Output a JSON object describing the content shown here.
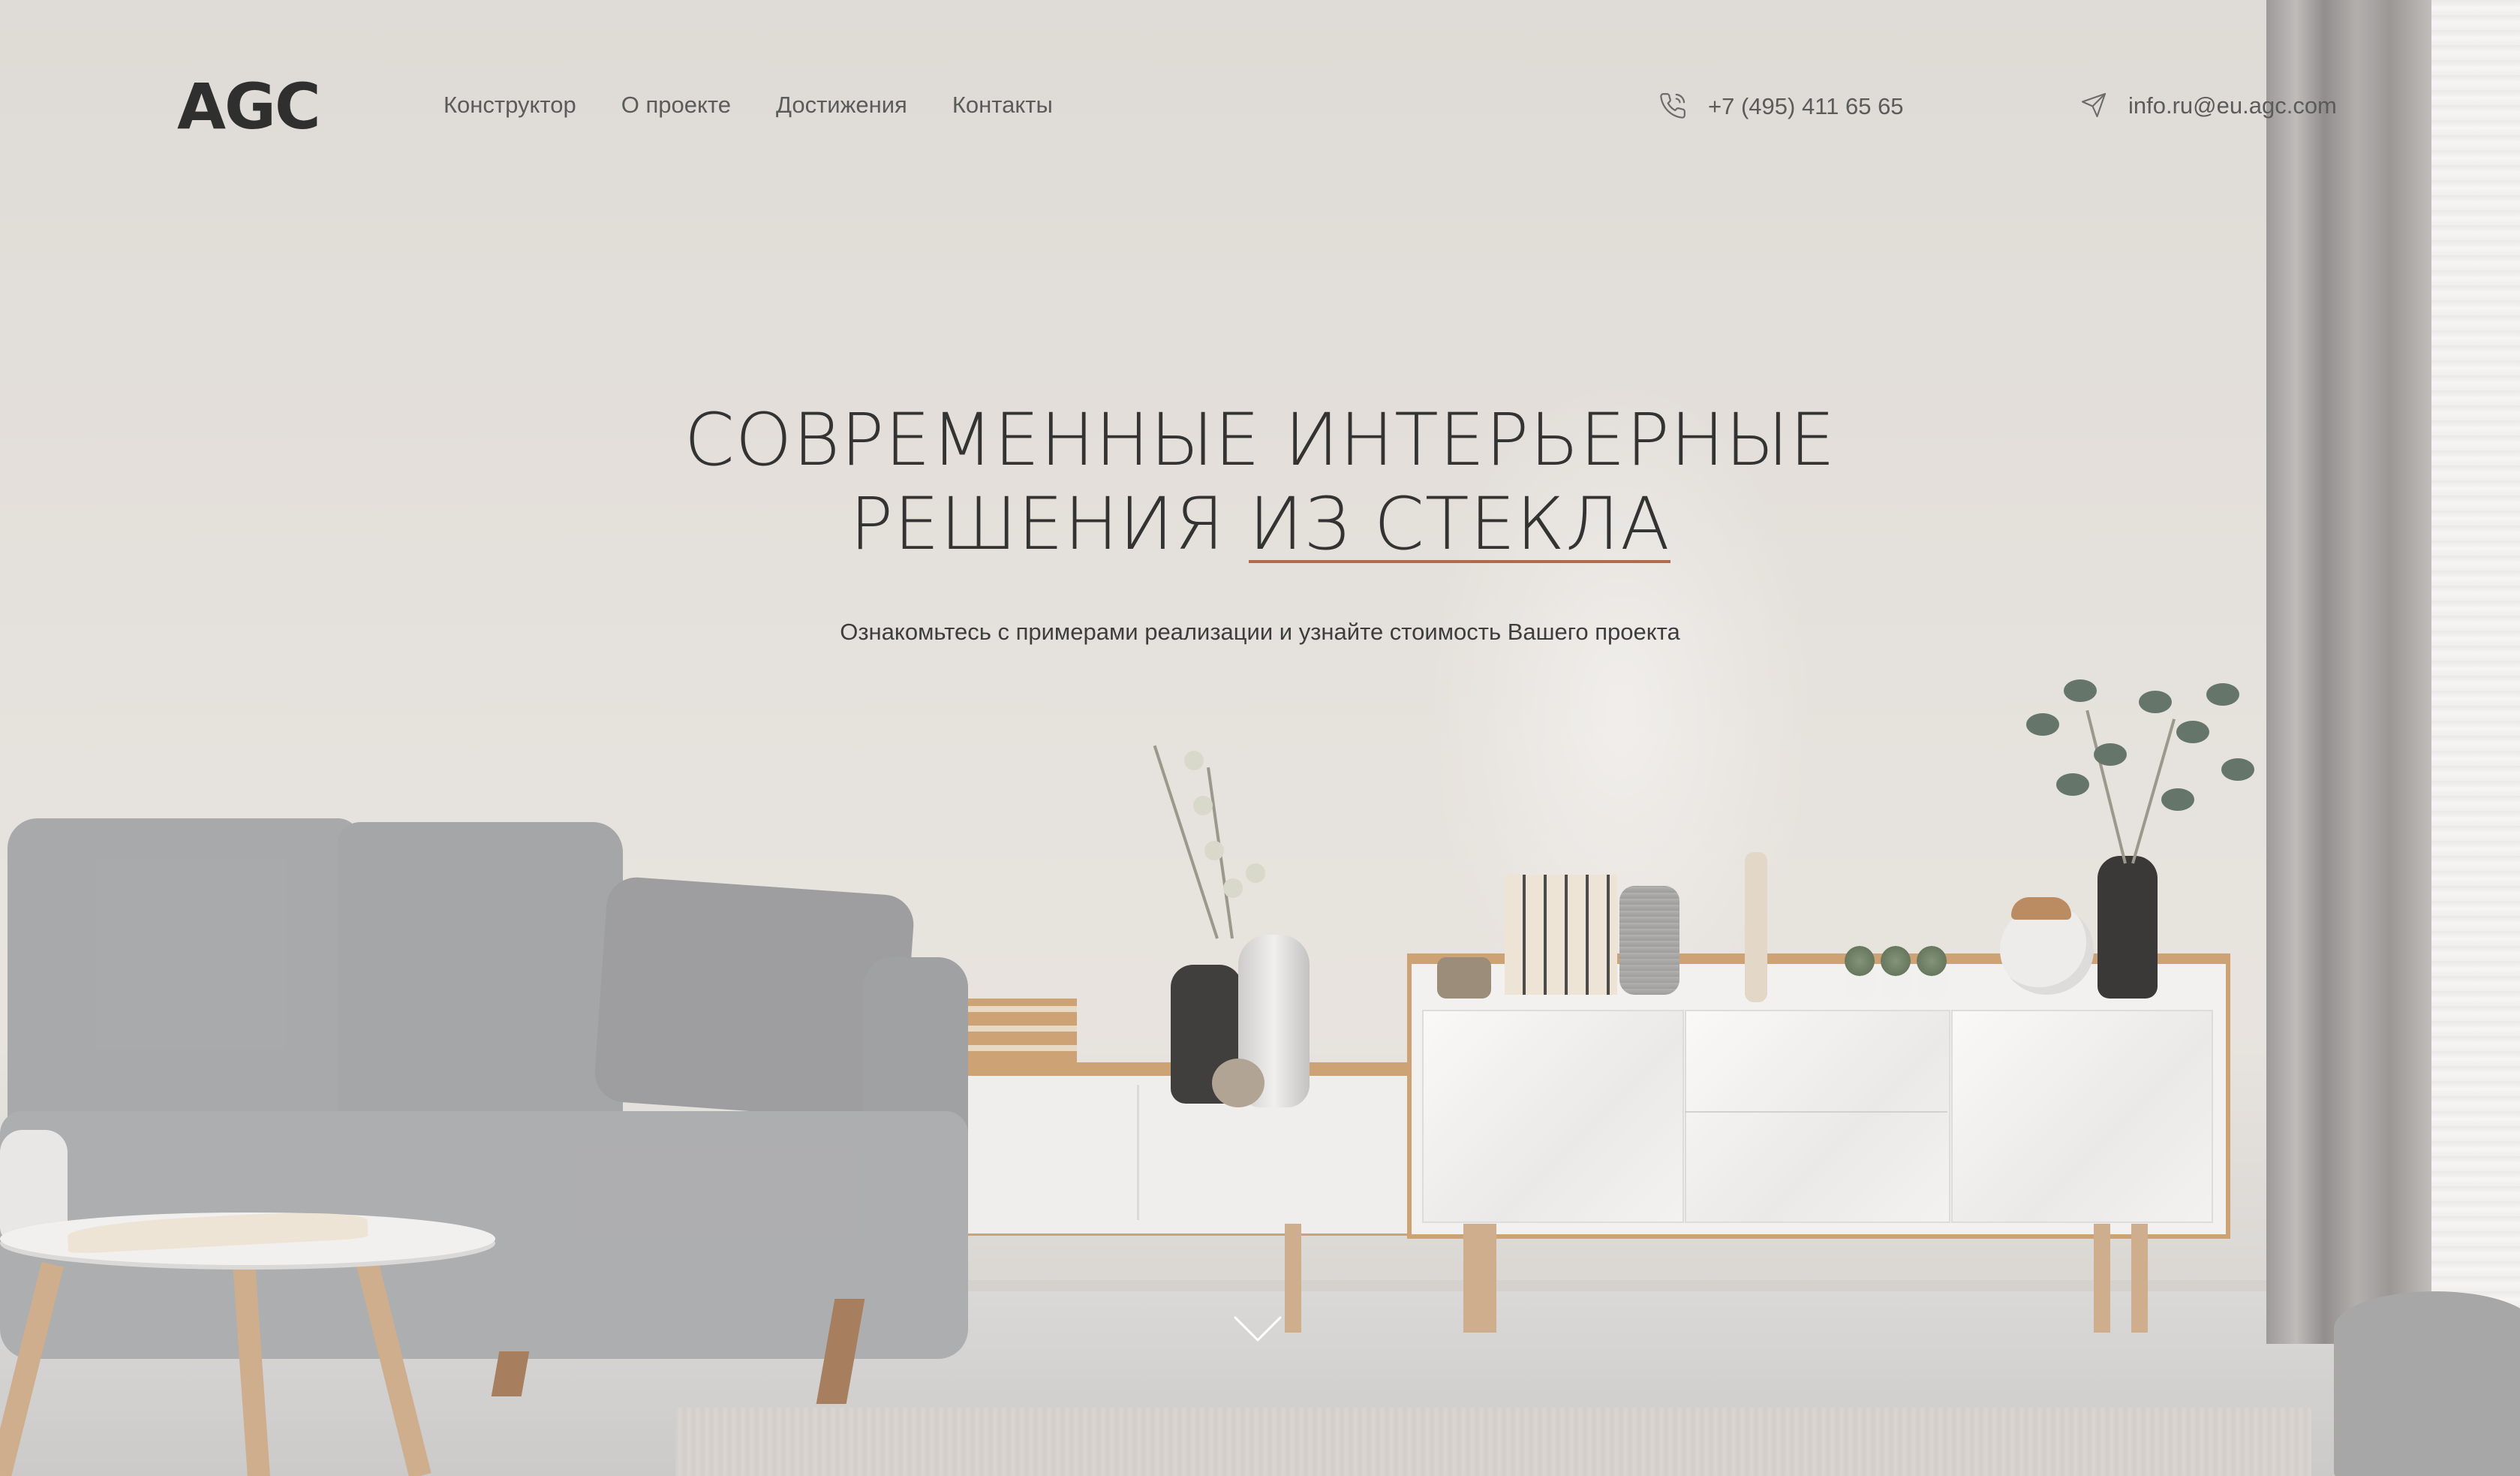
{
  "brand": {
    "logo_text": "AGC"
  },
  "nav": {
    "items": [
      {
        "label": "Конструктор"
      },
      {
        "label": "О проекте"
      },
      {
        "label": "Достижения"
      },
      {
        "label": "Контакты"
      }
    ]
  },
  "contacts": {
    "phone": "+7 (495) 411 65 65",
    "phone_icon": "phone-icon",
    "email": "info.ru@eu.agc.com",
    "email_icon": "paper-plane-icon"
  },
  "hero": {
    "title_line1": "СОВРЕМЕННЫЕ ИНТЕРЬЕРНЫЕ",
    "title_line2_plain": "РЕШЕНИЯ ",
    "title_line2_accent": "ИЗ СТЕКЛА",
    "subtitle": "Ознакомьтесь с примерами реализации и узнайте стоимость Вашего проекта",
    "scroll_icon": "chevron-down-icon",
    "accent_color": "#b06a4c"
  }
}
